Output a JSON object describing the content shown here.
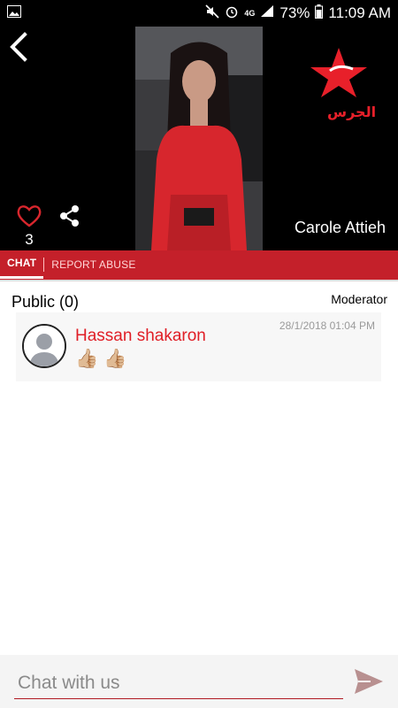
{
  "status_bar": {
    "network": "4G",
    "battery": "73%",
    "time": "11:09 AM"
  },
  "video": {
    "host_name": "Carole Attieh",
    "like_count": "3",
    "logo_text": "الجرس"
  },
  "tabs": [
    {
      "label": "CHAT",
      "active": true
    },
    {
      "label": "REPORT ABUSE",
      "active": false
    }
  ],
  "chat": {
    "channel_label": "Public (0)",
    "moderator_label": "Moderator",
    "messages": [
      {
        "sender": "Hassan shakaron",
        "timestamp": "28/1/2018 01:04 PM",
        "text": "👍🏼 👍🏼"
      }
    ]
  },
  "composer": {
    "placeholder": "Chat with us",
    "value": ""
  },
  "colors": {
    "accent": "#c4202a",
    "sender_name": "#e01e26"
  }
}
